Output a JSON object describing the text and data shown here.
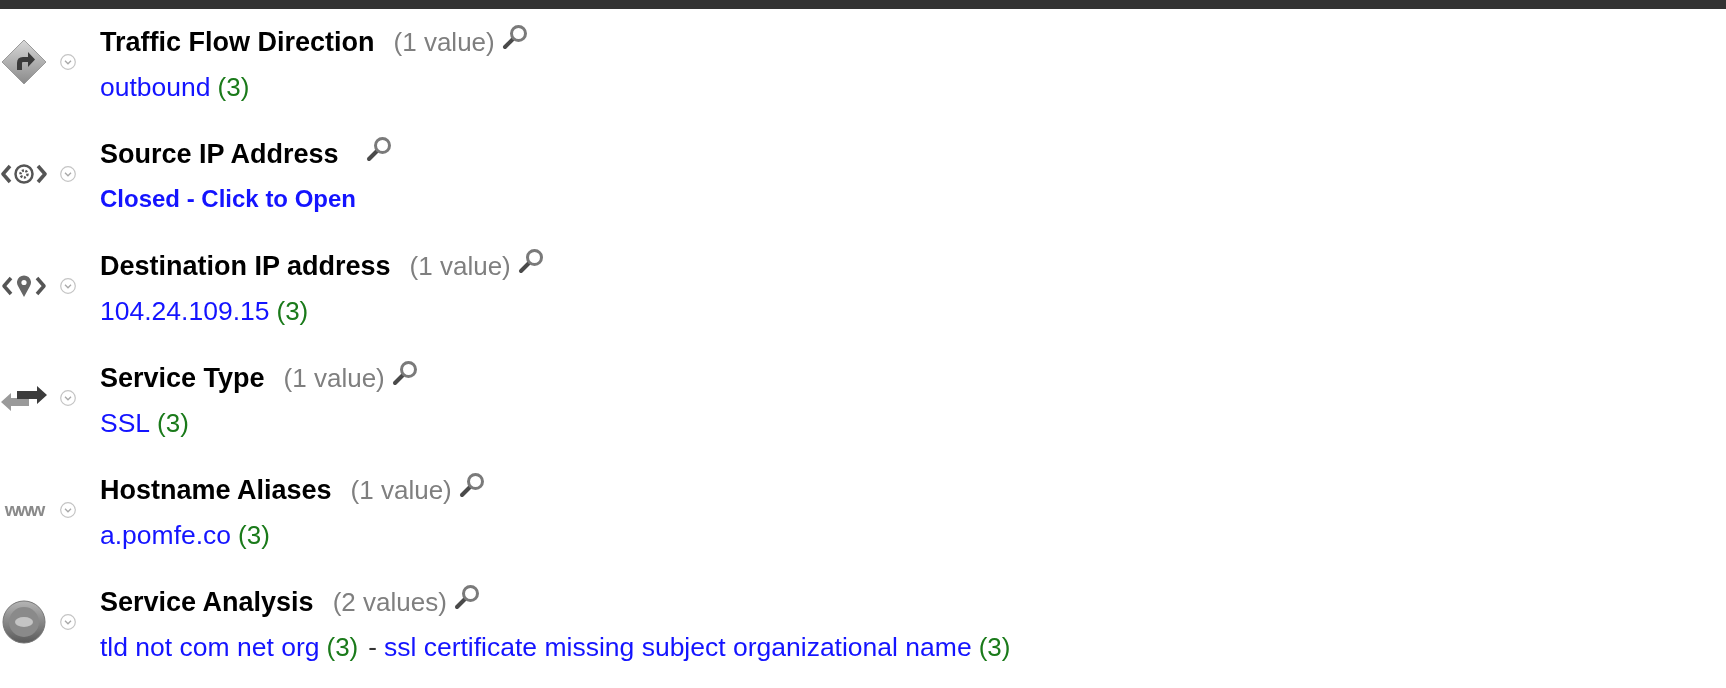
{
  "sections": [
    {
      "title": "Traffic Flow Direction",
      "count": "(1 value)",
      "closed": false,
      "values": [
        {
          "text": "outbound",
          "count": "(3)"
        }
      ]
    },
    {
      "title": "Source IP Address",
      "closed": true,
      "toggle": "Closed - Click to Open"
    },
    {
      "title": "Destination IP address",
      "count": "(1 value)",
      "closed": false,
      "values": [
        {
          "text": "104.24.109.15",
          "count": "(3)"
        }
      ]
    },
    {
      "title": "Service Type",
      "count": "(1 value)",
      "closed": false,
      "values": [
        {
          "text": "SSL",
          "count": "(3)"
        }
      ]
    },
    {
      "title": "Hostname Aliases",
      "icon_text": "www",
      "count": "(1 value)",
      "closed": false,
      "values": [
        {
          "text": "a.pomfe.co",
          "count": "(3)"
        }
      ]
    },
    {
      "title": "Service Analysis",
      "count": "(2 values)",
      "closed": false,
      "separator": "-",
      "values": [
        {
          "text": "tld not com net org",
          "count": "(3)"
        },
        {
          "text": "ssl certificate missing subject organizational name",
          "count": "(3)"
        }
      ]
    }
  ]
}
